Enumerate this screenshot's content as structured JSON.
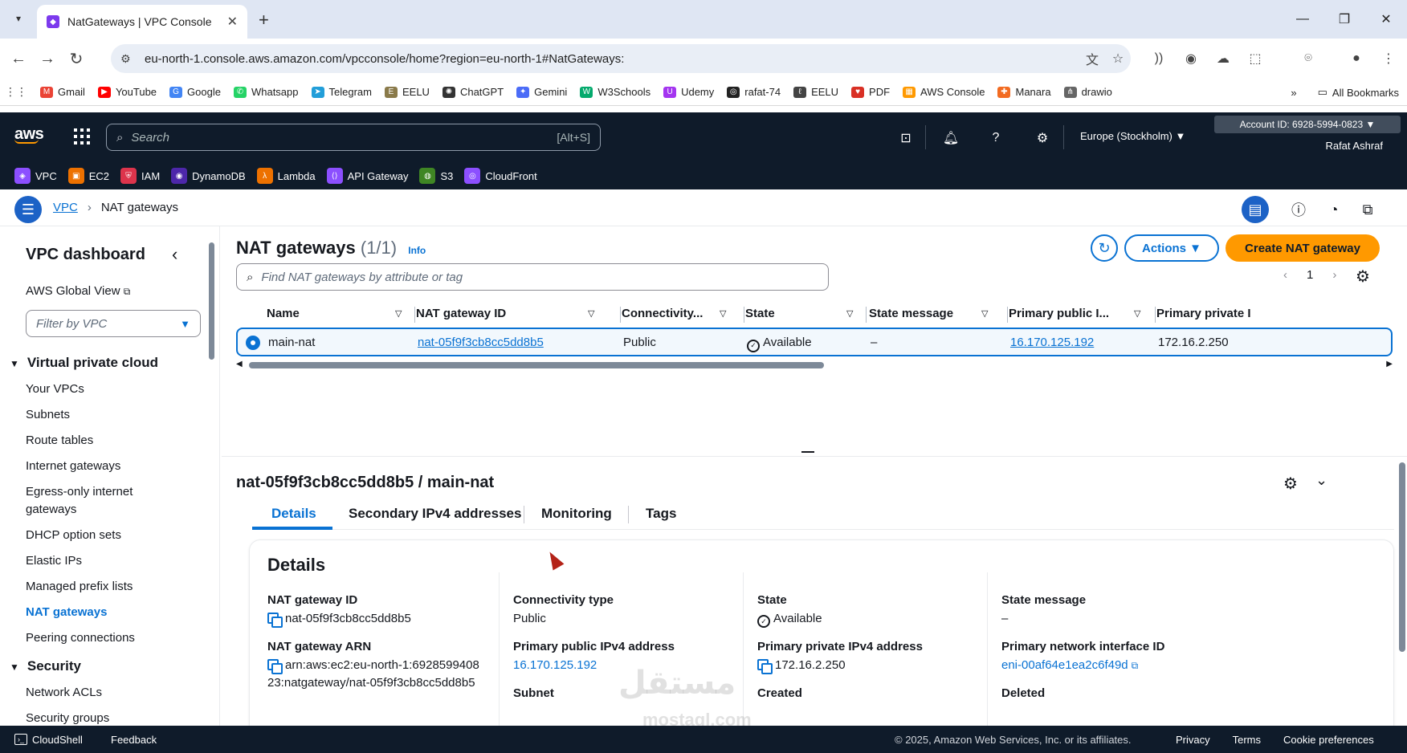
{
  "browser": {
    "tab_title": "NatGateways | VPC Console",
    "url": "eu-north-1.console.aws.amazon.com/vpcconsole/home?region=eu-north-1#NatGateways:",
    "bookmarks": [
      "Gmail",
      "YouTube",
      "Google",
      "Whatsapp",
      "Telegram",
      "EELU",
      "ChatGPT",
      "Gemini",
      "W3Schools",
      "Udemy",
      "rafat-74",
      "EELU",
      "PDF",
      "AWS Console",
      "Manara",
      "drawio"
    ],
    "all_bookmarks": "All Bookmarks"
  },
  "aws": {
    "search_placeholder": "Search",
    "search_shortcut": "[Alt+S]",
    "region": "Europe (Stockholm) ▼",
    "account": "Account ID: 6928-5994-0823 ▼",
    "user": "Rafat Ashraf",
    "favorites": [
      "VPC",
      "EC2",
      "IAM",
      "DynamoDB",
      "Lambda",
      "API Gateway",
      "S3",
      "CloudFront"
    ]
  },
  "breadcrumb": {
    "root": "VPC",
    "current": "NAT gateways"
  },
  "sidenav": {
    "title": "VPC dashboard",
    "global_view": "AWS Global View",
    "filter_placeholder": "Filter by VPC",
    "section_vpc": "Virtual private cloud",
    "items": [
      "Your VPCs",
      "Subnets",
      "Route tables",
      "Internet gateways",
      "Egress-only internet",
      "gateways",
      "DHCP option sets",
      "Elastic IPs",
      "Managed prefix lists",
      "NAT gateways",
      "Peering connections"
    ],
    "section_security": "Security",
    "security_items": [
      "Network ACLs",
      "Security groups"
    ]
  },
  "table": {
    "title": "NAT gateways",
    "count": "(1/1)",
    "info": "Info",
    "actions": "Actions ▼",
    "create": "Create NAT gateway",
    "search_placeholder": "Find NAT gateways by attribute or tag",
    "page": "1",
    "columns": [
      "Name",
      "NAT gateway ID",
      "Connectivity...",
      "State",
      "State message",
      "Primary public I...",
      "Primary private I"
    ],
    "row": {
      "name": "main-nat",
      "id": "nat-05f9f3cb8cc5dd8b5",
      "connectivity": "Public",
      "state": "Available",
      "state_message": "–",
      "public_ip": "16.170.125.192",
      "private_ip": "172.16.2.250"
    }
  },
  "details": {
    "header": "nat-05f9f3cb8cc5dd8b5 / main-nat",
    "tabs": [
      "Details",
      "Secondary IPv4 addresses",
      "Monitoring",
      "Tags"
    ],
    "card_title": "Details",
    "fields": {
      "nat_id_label": "NAT gateway ID",
      "nat_id": "nat-05f9f3cb8cc5dd8b5",
      "arn_label": "NAT gateway ARN",
      "arn_line1": "arn:aws:ec2:eu-north-1:6928599408",
      "arn_line2": "23:natgateway/nat-05f9f3cb8cc5dd8b5",
      "conn_label": "Connectivity type",
      "conn": "Public",
      "pub_label": "Primary public IPv4 address",
      "pub": "16.170.125.192",
      "subnet_label": "Subnet",
      "state_label": "State",
      "state": "Available",
      "priv_label": "Primary private IPv4 address",
      "priv": "172.16.2.250",
      "created_label": "Created",
      "msg_label": "State message",
      "msg": "–",
      "eni_label": "Primary network interface ID",
      "eni": "eni-00af64e1ea2c6f49d",
      "deleted_label": "Deleted"
    }
  },
  "footer": {
    "cloudshell": "CloudShell",
    "feedback": "Feedback",
    "copyright": "© 2025, Amazon Web Services, Inc. or its affiliates.",
    "privacy": "Privacy",
    "terms": "Terms",
    "cookies": "Cookie preferences"
  },
  "watermark": {
    "text": "مستقل",
    "site": "mostaql.com"
  }
}
